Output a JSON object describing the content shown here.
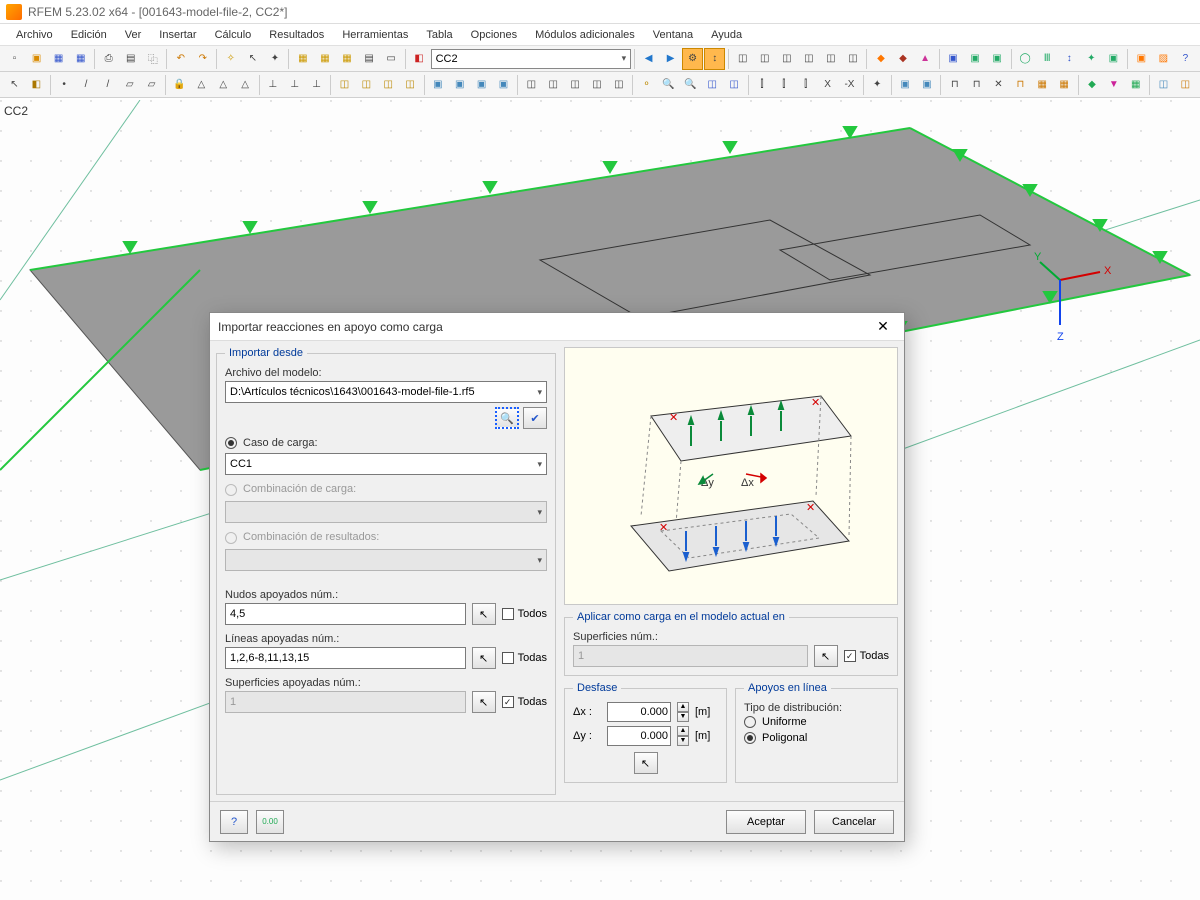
{
  "app": {
    "title": "RFEM 5.23.02 x64 - [001643-model-file-2, CC2*]"
  },
  "menu": {
    "archivo": "Archivo",
    "edicion": "Edición",
    "ver": "Ver",
    "insertar": "Insertar",
    "calculo": "Cálculo",
    "resultados": "Resultados",
    "herramientas": "Herramientas",
    "tabla": "Tabla",
    "opciones": "Opciones",
    "modulos": "Módulos adicionales",
    "ventana": "Ventana",
    "ayuda": "Ayuda"
  },
  "toolbar": {
    "cc_dropdown": "CC2"
  },
  "viewport": {
    "cc_label": "CC2",
    "axes": {
      "x": "X",
      "y": "Y",
      "z": "Z"
    }
  },
  "dialog": {
    "title": "Importar reacciones en apoyo como carga",
    "close": "✕",
    "importar_desde": {
      "legend": "Importar desde",
      "archivo_label": "Archivo del modelo:",
      "archivo_value": "D:\\Artículos técnicos\\1643\\001643-model-file-1.rf5",
      "caso_label": "Caso de carga:",
      "caso_value": "CC1",
      "comb_carga_label": "Combinación de carga:",
      "comb_res_label": "Combinación de resultados:",
      "nudos_label": "Nudos apoyados núm.:",
      "nudos_value": "4,5",
      "nudos_todos": "Todos",
      "lineas_label": "Líneas apoyadas núm.:",
      "lineas_value": "1,2,6-8,11,13,15",
      "lineas_todas": "Todas",
      "sup_label": "Superficies apoyadas núm.:",
      "sup_value": "1",
      "sup_todas": "Todas"
    },
    "aplicar": {
      "legend": "Aplicar como carga en el modelo actual en",
      "sup_label": "Superficies núm.:",
      "sup_value": "1",
      "todas": "Todas"
    },
    "desfase": {
      "legend": "Desfase",
      "dx_label": "Δx :",
      "dy_label": "Δy :",
      "dx_value": "0.000",
      "dy_value": "0.000",
      "unit": "[m]"
    },
    "apoyos": {
      "legend": "Apoyos en línea",
      "tipo_label": "Tipo de distribución:",
      "uniforme": "Uniforme",
      "poligonal": "Poligonal"
    },
    "preview": {
      "dx": "Δx",
      "dy": "Δy"
    },
    "buttons": {
      "aceptar": "Aceptar",
      "cancelar": "Cancelar"
    }
  }
}
